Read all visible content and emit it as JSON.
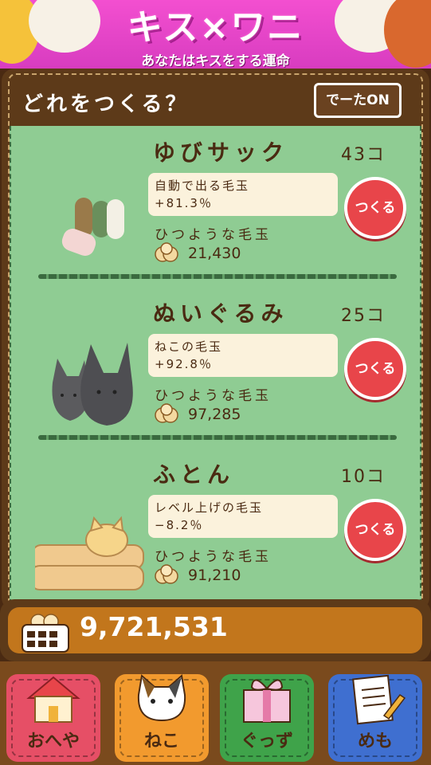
{
  "banner": {
    "title": "キス×ワニ",
    "subtitle": "あなたはキスをする運命"
  },
  "header": {
    "title": "どれをつくる？",
    "data_toggle": "でーたON"
  },
  "items": [
    {
      "name": "ゆびサック",
      "count": "43コ",
      "effect_label": "自動で出る毛玉",
      "effect_value": "+81.3％",
      "required_label": "ひつような毛玉",
      "cost": "21,430",
      "button": "つくる"
    },
    {
      "name": "ぬいぐるみ",
      "count": "25コ",
      "effect_label": "ねこの毛玉",
      "effect_value": "+92.8％",
      "required_label": "ひつような毛玉",
      "cost": "97,285",
      "button": "つくる"
    },
    {
      "name": "ふとん",
      "count": "10コ",
      "effect_label": "レベル上げの毛玉",
      "effect_value": "−8.2％",
      "required_label": "ひつような毛玉",
      "cost": "91,210",
      "button": "つくる"
    }
  ],
  "currency": {
    "value": "9,721,531",
    "icon": "basket-icon"
  },
  "nav": [
    {
      "label": "おへや",
      "icon": "house-icon",
      "color": "#e64f66"
    },
    {
      "label": "ねこ",
      "icon": "cat-face-icon",
      "color": "#f29a2e"
    },
    {
      "label": "ぐっず",
      "icon": "gift-box-icon",
      "color": "#3fa34a"
    },
    {
      "label": "めも",
      "icon": "memo-icon",
      "color": "#3f6fd0"
    }
  ],
  "colors": {
    "accent": "#e8454a",
    "list_bg": "#8fcc93",
    "panel": "#5d3a19"
  }
}
